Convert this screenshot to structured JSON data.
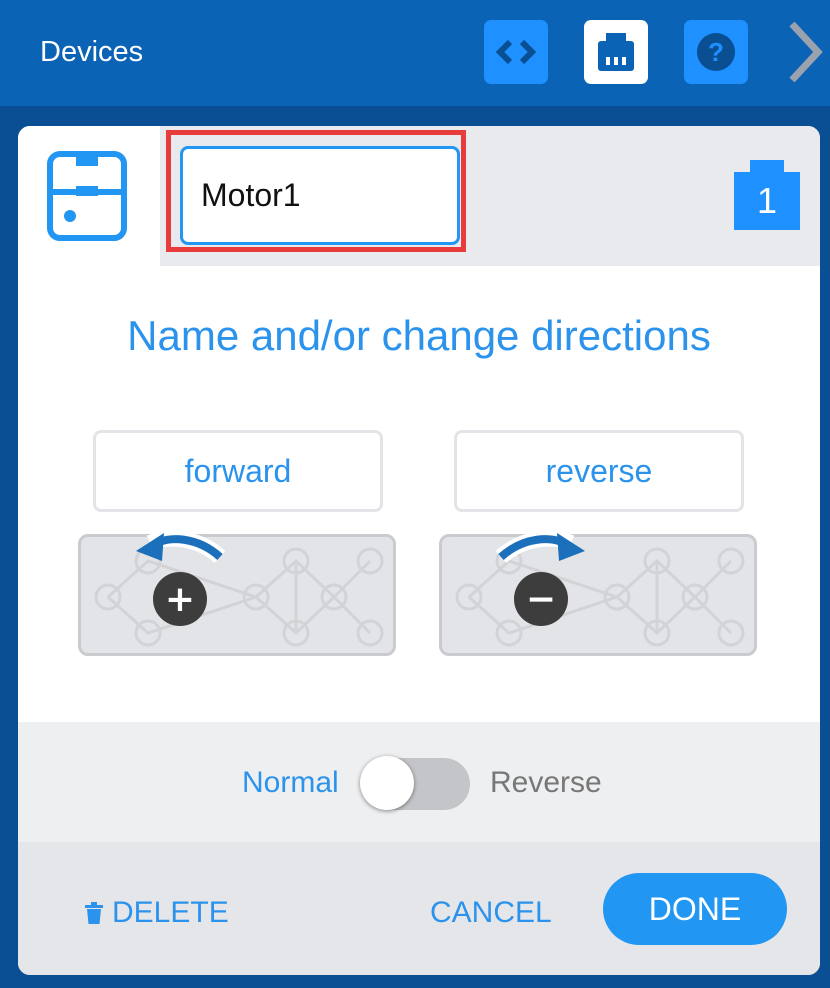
{
  "header": {
    "title": "Devices",
    "buttons": [
      {
        "icon": "code-brackets-icon"
      },
      {
        "icon": "device-port-icon"
      },
      {
        "icon": "help-icon"
      }
    ],
    "next_icon": "chevron-right-icon"
  },
  "dialog": {
    "device_icon": "motor-device-icon",
    "name_field": {
      "value": "Motor1",
      "placeholder": ""
    },
    "port": {
      "number": "1",
      "icon": "port-icon"
    },
    "heading": "Name and/or change directions",
    "directions": {
      "forward_label": "forward",
      "reverse_label": "reverse",
      "forward_symbol": "+",
      "reverse_symbol": "−"
    },
    "toggle": {
      "left_label": "Normal",
      "right_label": "Reverse",
      "state": "Normal"
    },
    "footer": {
      "delete_label": "DELETE",
      "cancel_label": "CANCEL",
      "done_label": "DONE"
    }
  },
  "colors": {
    "header_bg": "#0b63b6",
    "page_bg": "#0a4f93",
    "accent": "#2196f3",
    "text_blue": "#2b93ec",
    "highlight_red": "#e83b3b"
  }
}
